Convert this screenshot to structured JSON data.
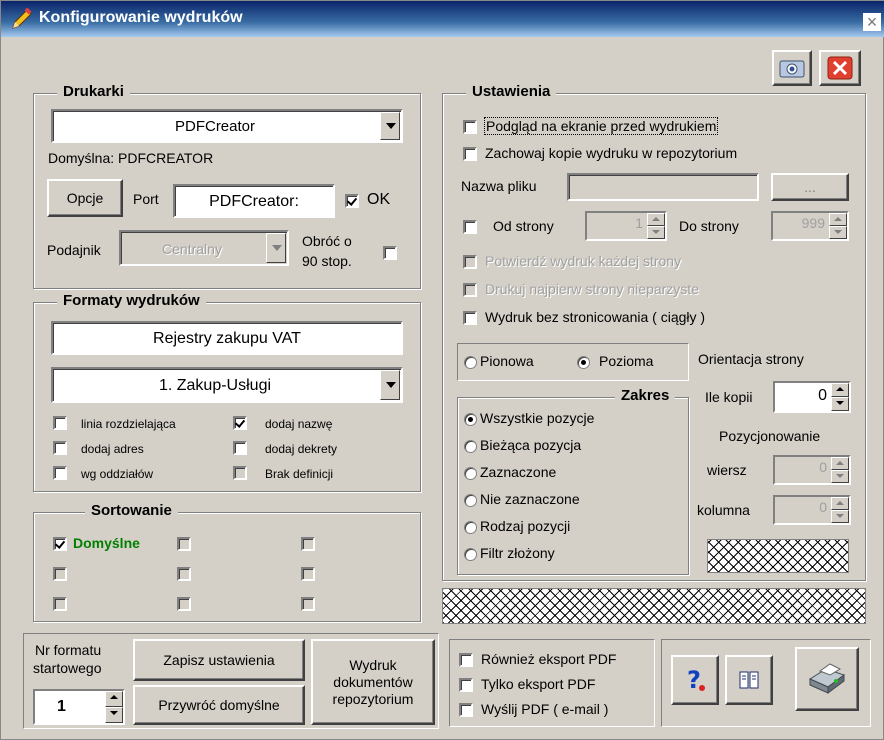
{
  "window": {
    "title": "Konfigurowanie wydruków",
    "close_glyph": "×"
  },
  "printers": {
    "group_label": "Drukarki",
    "selected_printer": "PDFCreator",
    "default_text": "Domyślna: PDFCREATOR",
    "options_button": "Opcje",
    "port_label": "Port",
    "port_value": "PDFCreator:",
    "ok_label": "OK",
    "ok_checked": true,
    "tray_label": "Podajnik",
    "tray_value": "Centralny",
    "rotate_label_1": "Obróć o",
    "rotate_label_2": "90 stop."
  },
  "formats": {
    "group_label": "Formaty wydruków",
    "register_name": "Rejestry zakupu VAT",
    "selected_format": "1. Zakup-Usługi",
    "options": [
      {
        "label": "linia rozdzielająca",
        "checked": false
      },
      {
        "label": "dodaj nazwę",
        "checked": true
      },
      {
        "label": "dodaj adres",
        "checked": false
      },
      {
        "label": "dodaj dekrety",
        "checked": false
      },
      {
        "label": "wg oddziałów",
        "checked": false
      },
      {
        "label": "Brak definicji",
        "checked": false
      }
    ]
  },
  "sorting": {
    "group_label": "Sortowanie",
    "default_label": "Domyślne"
  },
  "settings": {
    "group_label": "Ustawienia",
    "preview_label": "Podgląd na ekranie przed wydrukiem",
    "keep_copies_label": "Zachowaj kopie wydruku w repozytorium",
    "filename_label": "Nazwa pliku",
    "filename_value": "",
    "browse_label": "...",
    "from_page_label": "Od strony",
    "from_page_value": "1",
    "to_page_label": "Do strony",
    "to_page_value": "999",
    "confirm_each_label": "Potwierdź wydruk każdej strony",
    "odd_first_label": "Drukuj najpierw strony nieparzyste",
    "continuous_label": "Wydruk bez stronicowania ( ciągły )",
    "orientation_portrait": "Pionowa",
    "orientation_landscape": "Pozioma",
    "orientation_label": "Orientacja strony",
    "orientation_selected": "landscape",
    "range_label": "Zakres",
    "range_options": [
      "Wszystkie pozycje",
      "Bieżąca pozycja",
      "Zaznaczone",
      "Nie zaznaczone",
      "Rodzaj pozycji",
      "Filtr złożony"
    ],
    "range_selected_index": 0,
    "copies_label": "Ile kopii",
    "copies_value": "0",
    "positioning_label": "Pozycjonowanie",
    "row_label": "wiersz",
    "row_value": "0",
    "column_label": "kolumna",
    "column_value": "0"
  },
  "bottom": {
    "start_format_label_1": "Nr formatu",
    "start_format_label_2": "startowego",
    "start_format_value": "1",
    "save_button": "Zapisz ustawienia",
    "restore_button": "Przywróć domyślne",
    "repo_button_1": "Wydruk",
    "repo_button_2": "dokumentów",
    "repo_button_3": "repozytorium",
    "export_also_pdf": "Również eksport PDF",
    "export_only_pdf": "Tylko eksport PDF",
    "send_pdf": "Wyślij PDF ( e-mail )"
  }
}
